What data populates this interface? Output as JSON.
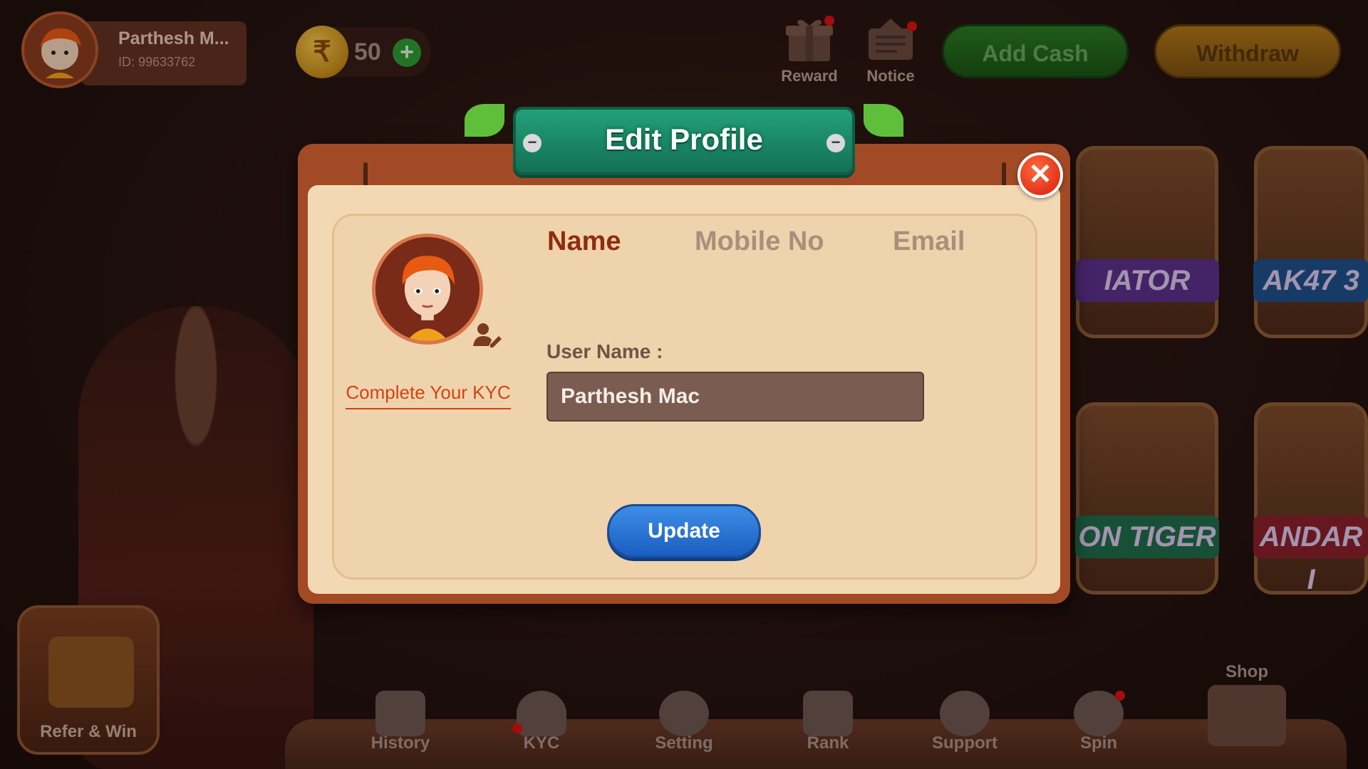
{
  "header": {
    "player_name": "Parthesh M...",
    "player_id": "ID: 99633762",
    "currency_symbol": "₹",
    "coin_balance": "50",
    "plus_symbol": "+",
    "reward_label": "Reward",
    "notice_label": "Notice",
    "add_cash_label": "Add Cash",
    "withdraw_label": "Withdraw"
  },
  "games": [
    {
      "label": "IATOR"
    },
    {
      "label": "AK47 3"
    },
    {
      "label": "ON TIGER"
    },
    {
      "label": "ANDAR I"
    }
  ],
  "modal": {
    "title": "Edit Profile",
    "close_symbol": "✕",
    "minus_symbol": "−",
    "kyc_link": "Complete Your KYC",
    "tabs": [
      {
        "label": "Name",
        "active": true
      },
      {
        "label": "Mobile No",
        "active": false
      },
      {
        "label": "Email",
        "active": false
      }
    ],
    "field_label": "User Name :",
    "field_value": "Parthesh Mac",
    "update_label": "Update"
  },
  "bottom_nav": [
    {
      "label": "History",
      "icon": "history-icon"
    },
    {
      "label": "KYC",
      "icon": "kyc-icon"
    },
    {
      "label": "Setting",
      "icon": "gear-icon"
    },
    {
      "label": "Rank",
      "icon": "rank-icon"
    },
    {
      "label": "Support",
      "icon": "chat-icon"
    },
    {
      "label": "Spin",
      "icon": "spin-wheel-icon"
    }
  ],
  "refer_label": "Refer & Win",
  "shop_label": "Shop",
  "colors": {
    "accent_green": "#137053",
    "kyc_red": "#d24317",
    "update_blue": "#1b5dc0",
    "close_red": "#e2341a"
  }
}
